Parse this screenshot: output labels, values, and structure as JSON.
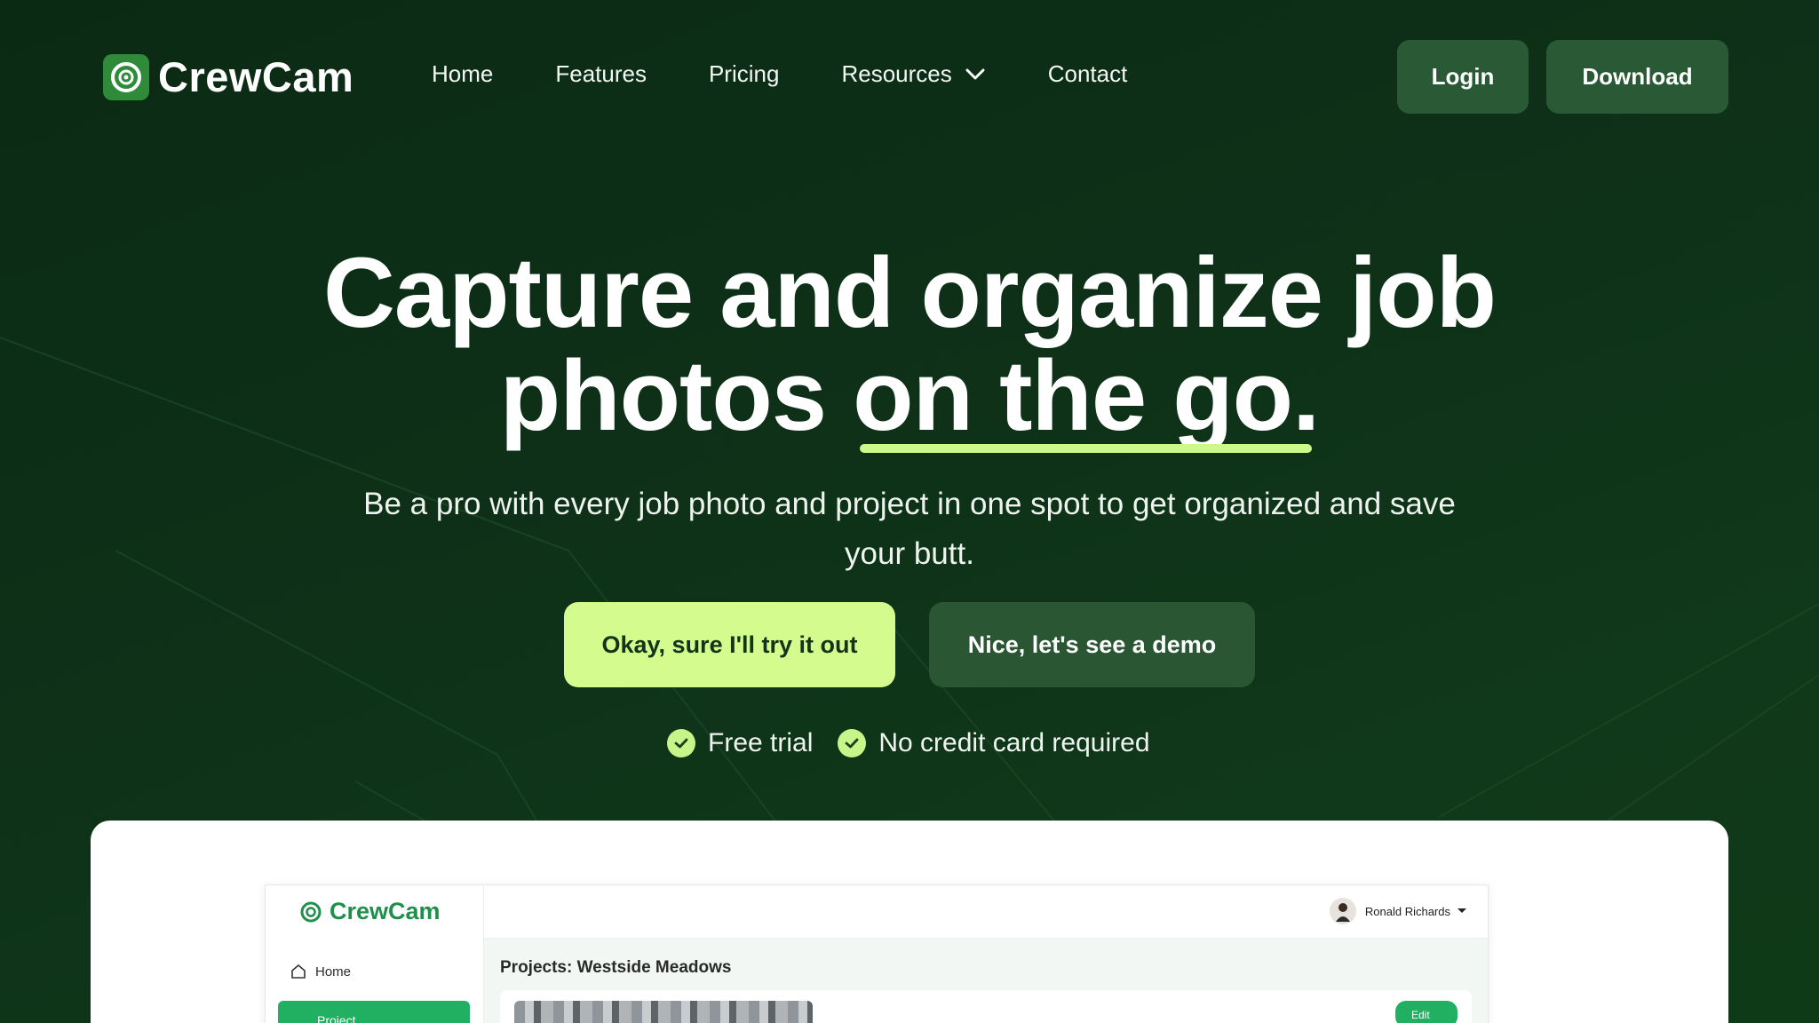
{
  "brand": {
    "name": "CrewCam",
    "accent": "#cdf88b",
    "bg": "#0e3118"
  },
  "nav": {
    "items": [
      {
        "label": "Home"
      },
      {
        "label": "Features"
      },
      {
        "label": "Pricing"
      },
      {
        "label": "Resources",
        "dropdown": true
      },
      {
        "label": "Contact"
      }
    ]
  },
  "header": {
    "login_label": "Login",
    "download_label": "Download"
  },
  "hero": {
    "title_line1": "Capture and organize job",
    "title_line2_plain": "photos",
    "title_line2_highlight": "on the go.",
    "subtitle": "Be a pro with every job photo and project in one spot to get organized and save your butt.",
    "cta_primary": "Okay, sure I'll try it out",
    "cta_secondary": "Nice, let's see a demo",
    "perks": [
      "Free trial",
      "No credit card required"
    ]
  },
  "preview": {
    "app_name": "CrewCam",
    "sidebar": {
      "home_label": "Home",
      "project_label": "Project"
    },
    "user_name": "Ronald Richards",
    "page_title": "Projects: Westside Meadows",
    "edit_label": "Edit"
  }
}
